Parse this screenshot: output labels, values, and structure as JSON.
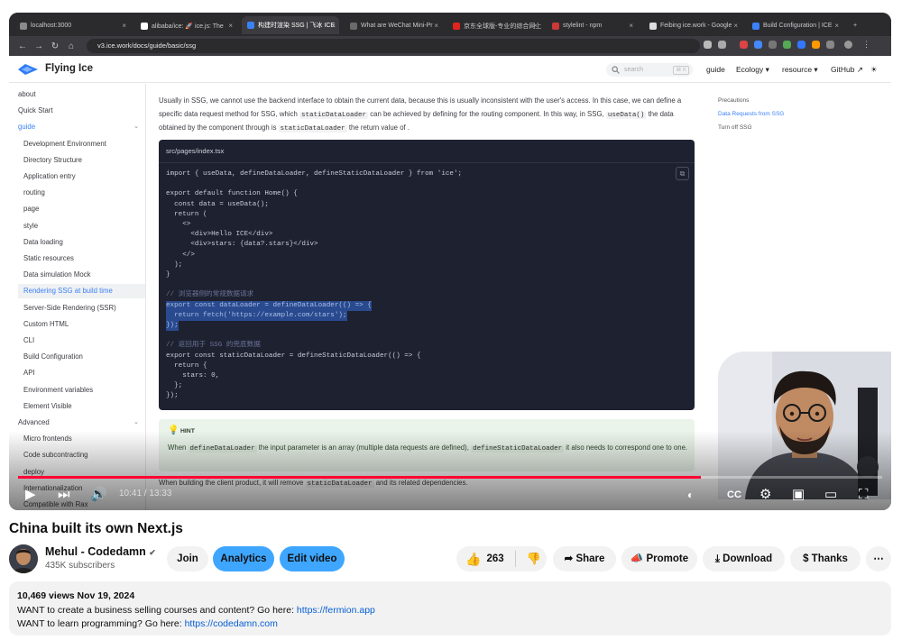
{
  "browser": {
    "tabs": [
      {
        "label": "localhost:3000",
        "color": "#8a8a8a"
      },
      {
        "label": "alibaba/ice: 🚀 ice.js: The",
        "color": "#ffffff"
      },
      {
        "label": "构建时渲染 SSG | 飞冰 ICE",
        "color": "#3b82f6"
      },
      {
        "label": "What are WeChat Mini-Pr",
        "color": "#6a6a6a"
      },
      {
        "label": "京东全球版-专业的综合网上",
        "color": "#e1251b"
      },
      {
        "label": "stylelint - npm",
        "color": "#cb3837"
      },
      {
        "label": "Feibing ice.work - Google",
        "color": "#dddddd"
      },
      {
        "label": "Build Configuration | ICE",
        "color": "#3b82f6"
      }
    ],
    "url": "v3.ice.work/docs/guide/basic/ssg"
  },
  "site": {
    "brand": "Flying Ice",
    "search_placeholder": "search",
    "search_key": "⌘ K",
    "nav": {
      "guide": "guide",
      "ecology": "Ecology ▾",
      "resource": "resource ▾",
      "github": "GitHub ↗",
      "theme": "☀"
    }
  },
  "sidebar": {
    "items": [
      {
        "label": "about",
        "kind": "top"
      },
      {
        "label": "Quick Start",
        "kind": "top"
      },
      {
        "label": "guide",
        "kind": "group"
      },
      {
        "label": "Development Environment",
        "kind": "child"
      },
      {
        "label": "Directory Structure",
        "kind": "child"
      },
      {
        "label": "Application entry",
        "kind": "child"
      },
      {
        "label": "routing",
        "kind": "child"
      },
      {
        "label": "page",
        "kind": "child"
      },
      {
        "label": "style",
        "kind": "child"
      },
      {
        "label": "Data loading",
        "kind": "child"
      },
      {
        "label": "Static resources",
        "kind": "child"
      },
      {
        "label": "Data simulation Mock",
        "kind": "child"
      },
      {
        "label": "Rendering SSG at build time",
        "kind": "active"
      },
      {
        "label": "Server-Side Rendering (SSR)",
        "kind": "child"
      },
      {
        "label": "Custom HTML",
        "kind": "child"
      },
      {
        "label": "CLI",
        "kind": "child"
      },
      {
        "label": "Build Configuration",
        "kind": "child"
      },
      {
        "label": "API",
        "kind": "child"
      },
      {
        "label": "Environment variables",
        "kind": "child"
      },
      {
        "label": "Element Visible",
        "kind": "child"
      },
      {
        "label": "Advanced",
        "kind": "top"
      },
      {
        "label": "Micro frontends",
        "kind": "child"
      },
      {
        "label": "Code subcontracting",
        "kind": "child"
      },
      {
        "label": "deploy",
        "kind": "child"
      },
      {
        "label": "Internationalization",
        "kind": "child"
      },
      {
        "label": "Compatible with Rax",
        "kind": "child"
      }
    ]
  },
  "content": {
    "para1": "Usually in SSG, we cannot use the backend interface to obtain the current data, because this is usually inconsistent with the user's access. In this case, we can define a specific data request method for SSG, which",
    "para1_code1": "staticDataLoader",
    "para1b": "can be achieved by defining for the routing component. In this way, in SSG,",
    "para1_code2": "useData()",
    "para1c": "the data obtained by the component through is",
    "para1_code3": "staticDataLoader",
    "para1d": "the return value of .",
    "code_file": "src/pages/index.tsx",
    "code_lines": [
      {
        "text": "import { useData, defineDataLoader, defineStaticDataLoader } from 'ice';",
        "kind": "code"
      },
      {
        "text": "",
        "kind": "code"
      },
      {
        "text": "export default function Home() {",
        "kind": "code"
      },
      {
        "text": "  const data = useData();",
        "kind": "code"
      },
      {
        "text": "  return (",
        "kind": "code"
      },
      {
        "text": "    <>",
        "kind": "code"
      },
      {
        "text": "      <div>Hello ICE</div>",
        "kind": "code"
      },
      {
        "text": "      <div>stars: {data?.stars}</div>",
        "kind": "code"
      },
      {
        "text": "    </>",
        "kind": "code"
      },
      {
        "text": "  );",
        "kind": "code"
      },
      {
        "text": "}",
        "kind": "code"
      },
      {
        "text": "",
        "kind": "code"
      },
      {
        "text": "// 浏览器侧的常规数据请求",
        "kind": "comment"
      },
      {
        "text": "export const dataLoader = defineDataLoader(() => {",
        "kind": "sel"
      },
      {
        "text": "  return fetch('https://example.com/stars');",
        "kind": "sel"
      },
      {
        "text": "});",
        "kind": "sel"
      },
      {
        "text": "",
        "kind": "code"
      },
      {
        "text": "// 返回用于 SSG 的兜底数据",
        "kind": "comment"
      },
      {
        "text": "export const staticDataLoader = defineStaticDataLoader(() => {",
        "kind": "code"
      },
      {
        "text": "  return {",
        "kind": "code"
      },
      {
        "text": "    stars: 0,",
        "kind": "code"
      },
      {
        "text": "  };",
        "kind": "code"
      },
      {
        "text": "});",
        "kind": "code"
      }
    ],
    "hint_title": "HINT",
    "hint_a": "When",
    "hint_code1": "defineDataLoader",
    "hint_b": "the input parameter is an array (multiple data requests are defined),",
    "hint_code2": "defineStaticDataLoader",
    "hint_c": "it also needs to correspond one to one.",
    "after_a": "When building the client product, it will remove",
    "after_code": "staticDataLoader",
    "after_b": "and its related dependencies."
  },
  "toc": {
    "items": [
      {
        "label": "Precautions",
        "active": false
      },
      {
        "label": "Data Requests from SSG",
        "active": true
      },
      {
        "label": "Turn off SSG",
        "active": false
      }
    ]
  },
  "player": {
    "current_time": "10:41 / 13:33",
    "progress": 0.79,
    "accent": "#ff0033"
  },
  "video": {
    "title": "China built its own Next.js",
    "channel": "Mehul - Codedamn",
    "verified": "✔",
    "subscribers": "435K subscribers",
    "join": "Join",
    "analytics": "Analytics",
    "edit": "Edit video",
    "likes": "263",
    "share": "Share",
    "promote": "Promote",
    "download": "Download",
    "thanks": "Thanks",
    "more": "⋯"
  },
  "description": {
    "meta": "10,469 views  Nov 19, 2024",
    "line1": "WANT to create a business selling courses and content? Go here: ",
    "link1": "https://fermion.app",
    "line2": "WANT to learn programming? Go here: ",
    "link2": "https://codedamn.com"
  }
}
